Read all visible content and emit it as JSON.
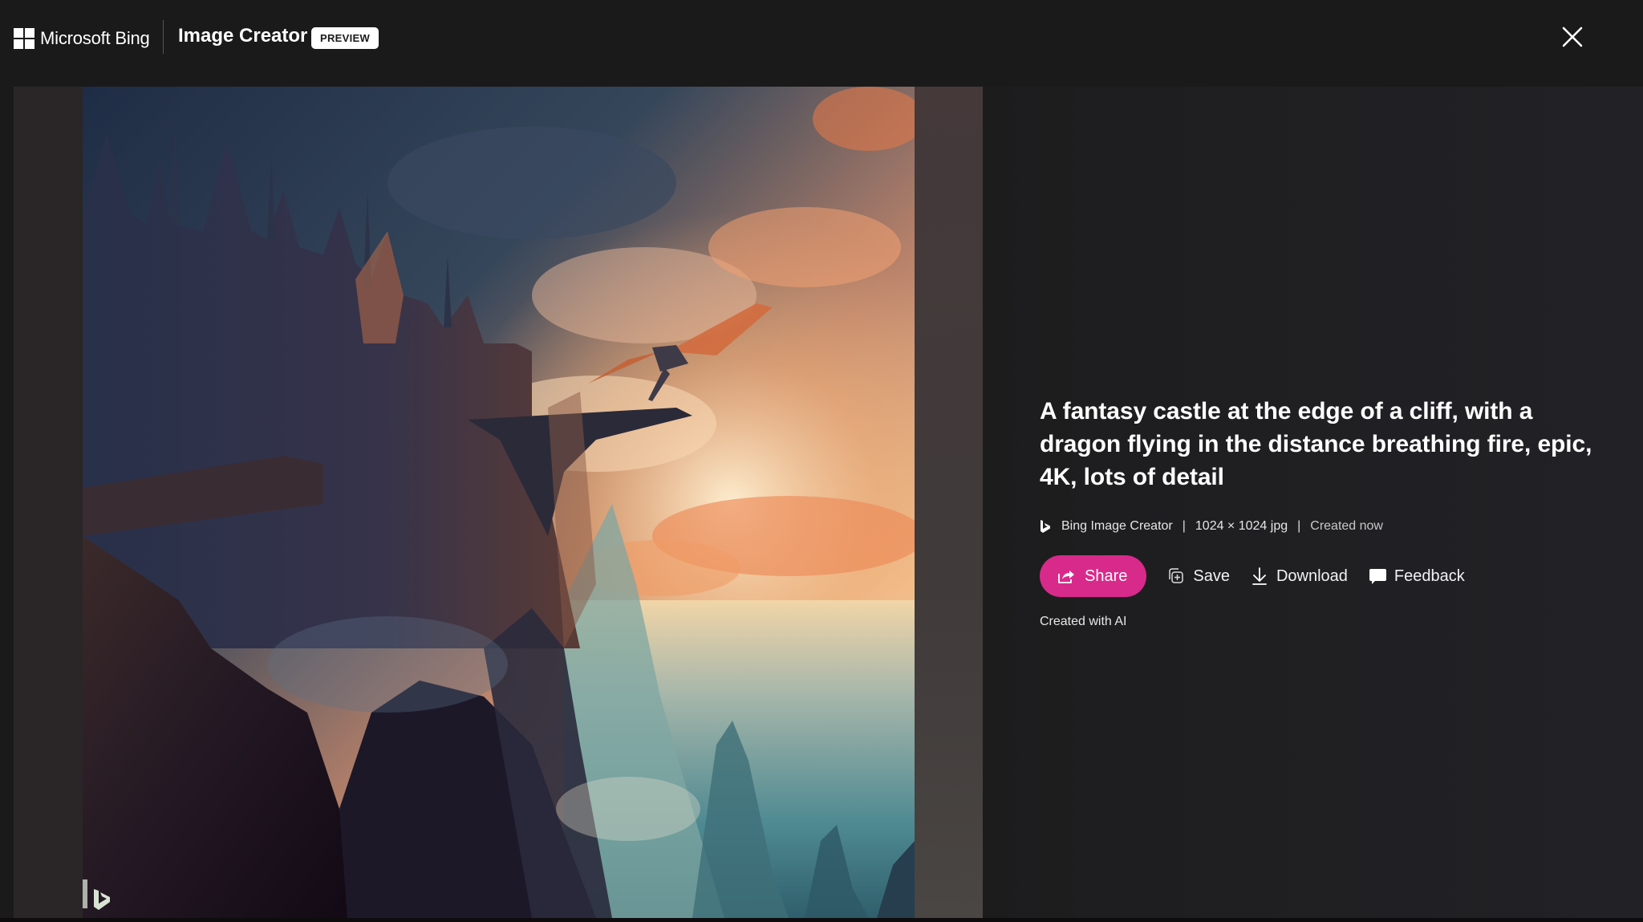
{
  "header": {
    "brand_name": "Microsoft Bing",
    "product_name": "Image Creator",
    "badge": "PREVIEW",
    "close_icon": "close-icon"
  },
  "image": {
    "alt": "A fantasy castle at the edge of a cliff, with a dragon flying in the distance breathing fire, epic, 4K, lots of detail",
    "watermark_icon": "bing-b-icon"
  },
  "details": {
    "prompt": "A fantasy castle at the edge of a cliff, with a dragon flying in the distance breathing fire, epic, 4K, lots of detail",
    "source_icon": "bing-b-icon",
    "source": "Bing Image Creator",
    "separator": "|",
    "dimensions": "1024 × 1024 jpg",
    "created": "Created now",
    "actions": [
      {
        "label": "Share",
        "icon": "share-icon"
      },
      {
        "label": "Save",
        "icon": "save-collection-icon"
      },
      {
        "label": "Download",
        "icon": "download-icon"
      },
      {
        "label": "Feedback",
        "icon": "feedback-icon"
      }
    ],
    "disclaimer": "Created with AI"
  },
  "colors": {
    "background": "#1b1a1a",
    "accent": "#d82a8b",
    "text": "#ffffff"
  }
}
